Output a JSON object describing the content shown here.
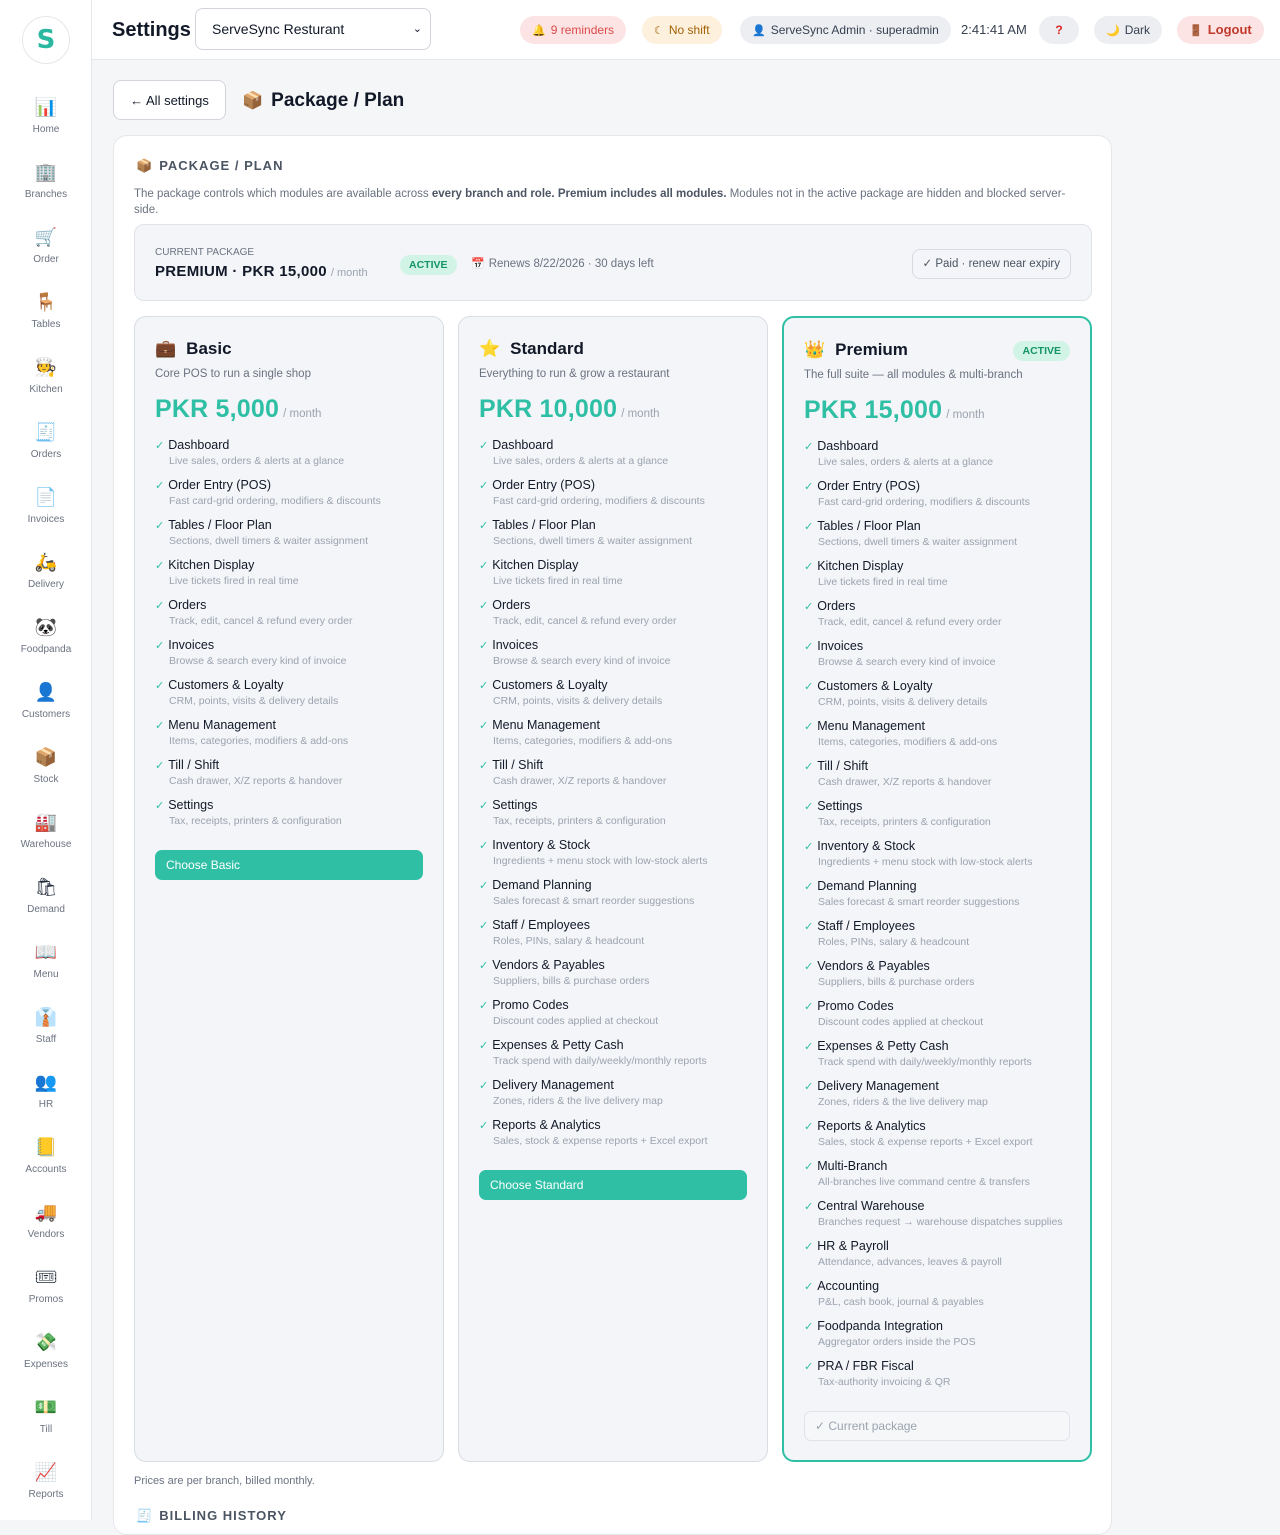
{
  "app": {
    "logo_letter": "S"
  },
  "sidebar": {
    "items": [
      {
        "label": "Home",
        "icon": "📊",
        "icon_name": "bar-chart-icon"
      },
      {
        "label": "Branches",
        "icon": "🏢",
        "icon_name": "building-icon"
      },
      {
        "label": "Order",
        "icon": "🛒",
        "icon_name": "cart-icon"
      },
      {
        "label": "Tables",
        "icon": "🪑",
        "icon_name": "chair-icon"
      },
      {
        "label": "Kitchen",
        "icon": "🧑‍🍳",
        "icon_name": "chef-icon"
      },
      {
        "label": "Orders",
        "icon": "🧾",
        "icon_name": "receipt-icon"
      },
      {
        "label": "Invoices",
        "icon": "📄",
        "icon_name": "document-icon"
      },
      {
        "label": "Delivery",
        "icon": "🛵",
        "icon_name": "scooter-icon"
      },
      {
        "label": "Foodpanda",
        "icon": "🐼",
        "icon_name": "panda-icon"
      },
      {
        "label": "Customers",
        "icon": "👤",
        "icon_name": "person-icon"
      },
      {
        "label": "Stock",
        "icon": "📦",
        "icon_name": "box-icon"
      },
      {
        "label": "Warehouse",
        "icon": "🏭",
        "icon_name": "factory-icon"
      },
      {
        "label": "Demand",
        "icon": "🛍",
        "icon_name": "shopping-bag-icon"
      },
      {
        "label": "Menu",
        "icon": "📖",
        "icon_name": "book-icon"
      },
      {
        "label": "Staff",
        "icon": "👔",
        "icon_name": "necktie-icon"
      },
      {
        "label": "HR",
        "icon": "👥",
        "icon_name": "people-icon"
      },
      {
        "label": "Accounts",
        "icon": "📒",
        "icon_name": "ledger-icon"
      },
      {
        "label": "Vendors",
        "icon": "🚚",
        "icon_name": "truck-icon"
      },
      {
        "label": "Promos",
        "icon": "🎟",
        "icon_name": "ticket-icon"
      },
      {
        "label": "Expenses",
        "icon": "💸",
        "icon_name": "money-wings-icon"
      },
      {
        "label": "Till",
        "icon": "💵",
        "icon_name": "cash-icon"
      },
      {
        "label": "Reports",
        "icon": "📈",
        "icon_name": "line-chart-icon"
      }
    ]
  },
  "topbar": {
    "title": "Settings",
    "branch_select": "ServeSync Resturant",
    "reminders": "9 reminders",
    "shift": "No shift",
    "user": "ServeSync Admin · superadmin",
    "time": "2:41:41 AM",
    "help": "?",
    "theme": "Dark",
    "logout": "Logout"
  },
  "page": {
    "back_label": "← All settings",
    "title": "Package / Plan",
    "section_title": "PACKAGE / PLAN",
    "desc_1": "The package controls which modules are available across ",
    "desc_2": "every branch and role.",
    "desc_3": " ",
    "desc_4": "Premium includes all modules.",
    "desc_5": " Modules not in the active package are hidden and blocked server-side.",
    "footnote": "Prices are per branch, billed monthly.",
    "billing_title": "BILLING HISTORY"
  },
  "current": {
    "label": "CURRENT PACKAGE",
    "name": "PREMIUM · PKR 15,000",
    "per": "/ month",
    "status": "ACTIVE",
    "renews": "Renews 8/22/2026 · 30 days left",
    "paid": "✓ Paid · renew near expiry"
  },
  "plans": [
    {
      "name": "Basic",
      "icon": "💼",
      "tagline": "Core POS to run a single shop",
      "price": "PKR 5,000",
      "per": "/ month",
      "button": "Choose Basic",
      "features": [
        {
          "name": "Dashboard",
          "desc": "Live sales, orders & alerts at a glance"
        },
        {
          "name": "Order Entry (POS)",
          "desc": "Fast card-grid ordering, modifiers & discounts"
        },
        {
          "name": "Tables / Floor Plan",
          "desc": "Sections, dwell timers & waiter assignment"
        },
        {
          "name": "Kitchen Display",
          "desc": "Live tickets fired in real time"
        },
        {
          "name": "Orders",
          "desc": "Track, edit, cancel & refund every order"
        },
        {
          "name": "Invoices",
          "desc": "Browse & search every kind of invoice"
        },
        {
          "name": "Customers & Loyalty",
          "desc": "CRM, points, visits & delivery details"
        },
        {
          "name": "Menu Management",
          "desc": "Items, categories, modifiers & add-ons"
        },
        {
          "name": "Till / Shift",
          "desc": "Cash drawer, X/Z reports & handover"
        },
        {
          "name": "Settings",
          "desc": "Tax, receipts, printers & configuration"
        }
      ]
    },
    {
      "name": "Standard",
      "icon": "⭐",
      "tagline": "Everything to run & grow a restaurant",
      "price": "PKR 10,000",
      "per": "/ month",
      "button": "Choose Standard",
      "features": [
        {
          "name": "Dashboard",
          "desc": "Live sales, orders & alerts at a glance"
        },
        {
          "name": "Order Entry (POS)",
          "desc": "Fast card-grid ordering, modifiers & discounts"
        },
        {
          "name": "Tables / Floor Plan",
          "desc": "Sections, dwell timers & waiter assignment"
        },
        {
          "name": "Kitchen Display",
          "desc": "Live tickets fired in real time"
        },
        {
          "name": "Orders",
          "desc": "Track, edit, cancel & refund every order"
        },
        {
          "name": "Invoices",
          "desc": "Browse & search every kind of invoice"
        },
        {
          "name": "Customers & Loyalty",
          "desc": "CRM, points, visits & delivery details"
        },
        {
          "name": "Menu Management",
          "desc": "Items, categories, modifiers & add-ons"
        },
        {
          "name": "Till / Shift",
          "desc": "Cash drawer, X/Z reports & handover"
        },
        {
          "name": "Settings",
          "desc": "Tax, receipts, printers & configuration"
        },
        {
          "name": "Inventory & Stock",
          "desc": "Ingredients + menu stock with low-stock alerts"
        },
        {
          "name": "Demand Planning",
          "desc": "Sales forecast & smart reorder suggestions"
        },
        {
          "name": "Staff / Employees",
          "desc": "Roles, PINs, salary & headcount"
        },
        {
          "name": "Vendors & Payables",
          "desc": "Suppliers, bills & purchase orders"
        },
        {
          "name": "Promo Codes",
          "desc": "Discount codes applied at checkout"
        },
        {
          "name": "Expenses & Petty Cash",
          "desc": "Track spend with daily/weekly/monthly reports"
        },
        {
          "name": "Delivery Management",
          "desc": "Zones, riders & the live delivery map"
        },
        {
          "name": "Reports & Analytics",
          "desc": "Sales, stock & expense reports + Excel export"
        }
      ]
    },
    {
      "name": "Premium",
      "icon": "👑",
      "tagline": "The full suite — all modules & multi-branch",
      "price": "PKR 15,000",
      "per": "/ month",
      "badge": "ACTIVE",
      "button": "✓ Current package",
      "features": [
        {
          "name": "Dashboard",
          "desc": "Live sales, orders & alerts at a glance"
        },
        {
          "name": "Order Entry (POS)",
          "desc": "Fast card-grid ordering, modifiers & discounts"
        },
        {
          "name": "Tables / Floor Plan",
          "desc": "Sections, dwell timers & waiter assignment"
        },
        {
          "name": "Kitchen Display",
          "desc": "Live tickets fired in real time"
        },
        {
          "name": "Orders",
          "desc": "Track, edit, cancel & refund every order"
        },
        {
          "name": "Invoices",
          "desc": "Browse & search every kind of invoice"
        },
        {
          "name": "Customers & Loyalty",
          "desc": "CRM, points, visits & delivery details"
        },
        {
          "name": "Menu Management",
          "desc": "Items, categories, modifiers & add-ons"
        },
        {
          "name": "Till / Shift",
          "desc": "Cash drawer, X/Z reports & handover"
        },
        {
          "name": "Settings",
          "desc": "Tax, receipts, printers & configuration"
        },
        {
          "name": "Inventory & Stock",
          "desc": "Ingredients + menu stock with low-stock alerts"
        },
        {
          "name": "Demand Planning",
          "desc": "Sales forecast & smart reorder suggestions"
        },
        {
          "name": "Staff / Employees",
          "desc": "Roles, PINs, salary & headcount"
        },
        {
          "name": "Vendors & Payables",
          "desc": "Suppliers, bills & purchase orders"
        },
        {
          "name": "Promo Codes",
          "desc": "Discount codes applied at checkout"
        },
        {
          "name": "Expenses & Petty Cash",
          "desc": "Track spend with daily/weekly/monthly reports"
        },
        {
          "name": "Delivery Management",
          "desc": "Zones, riders & the live delivery map"
        },
        {
          "name": "Reports & Analytics",
          "desc": "Sales, stock & expense reports + Excel export"
        },
        {
          "name": "Multi-Branch",
          "desc": "All-branches live command centre & transfers"
        },
        {
          "name": "Central Warehouse",
          "desc": "Branches request → warehouse dispatches supplies"
        },
        {
          "name": "HR & Payroll",
          "desc": "Attendance, advances, leaves & payroll"
        },
        {
          "name": "Accounting",
          "desc": "P&L, cash book, journal & payables"
        },
        {
          "name": "Foodpanda Integration",
          "desc": "Aggregator orders inside the POS"
        },
        {
          "name": "PRA / FBR Fiscal",
          "desc": "Tax-authority invoicing & QR"
        }
      ]
    }
  ],
  "colors": {
    "accent": "#2fbfa5",
    "active_badge_bg": "#d1f4e6",
    "logout_bg": "#fde4e4"
  }
}
